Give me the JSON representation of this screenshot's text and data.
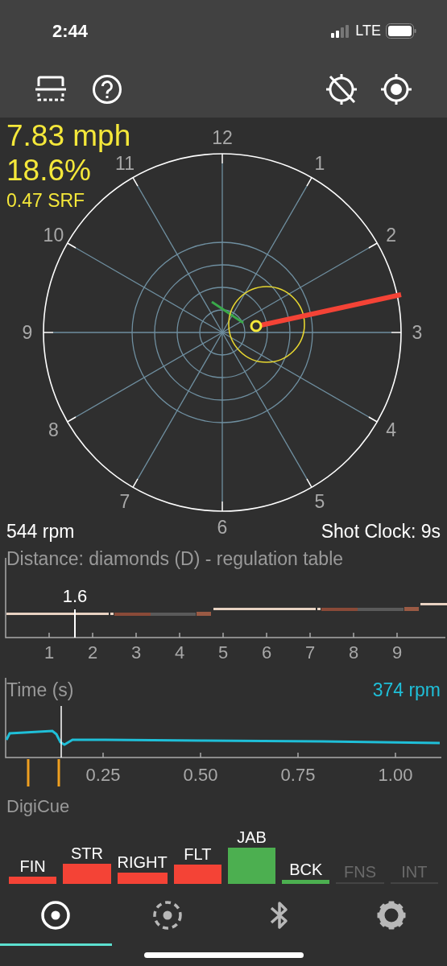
{
  "status_bar": {
    "time": "2:44",
    "network": "LTE"
  },
  "toolbar": [
    {
      "kind": "table"
    },
    {
      "kind": "help"
    },
    {
      "kind": "crosshair-off"
    },
    {
      "kind": "crosshair"
    }
  ],
  "readout": {
    "speed": "7.83 mph",
    "percent": "18.6%",
    "srf": "0.47 SRF"
  },
  "clock_labels": [
    "12",
    "1",
    "2",
    "3",
    "4",
    "5",
    "6",
    "7",
    "8",
    "9",
    "10",
    "11"
  ],
  "spin": "544 rpm",
  "shot_clock": "Shot Clock: 9s",
  "distance": {
    "title": "Distance: diamonds (D) - regulation table",
    "ticks": [
      "1",
      "2",
      "3",
      "4",
      "5",
      "6",
      "7",
      "8",
      "9"
    ],
    "marker": {
      "label": "1.6"
    }
  },
  "time": {
    "title": "Time (s)",
    "reading": "374 rpm",
    "ticks": [
      "0.25",
      "0.50",
      "0.75",
      "1.00"
    ]
  },
  "digicue": {
    "title": "DigiCue",
    "bars": [
      {
        "label": "FIN",
        "color": "#f44336",
        "disabled": false
      },
      {
        "label": "STR",
        "color": "#f44336",
        "disabled": false
      },
      {
        "label": "RIGHT",
        "color": "#f44336",
        "disabled": false
      },
      {
        "label": "FLT",
        "color": "#f44336",
        "disabled": false
      },
      {
        "label": "JAB",
        "color": "#4caf50",
        "disabled": false
      },
      {
        "label": "BCK",
        "color": "#4caf50",
        "disabled": false
      },
      {
        "label": "FNS",
        "color": "#444444",
        "disabled": true
      },
      {
        "label": "INT",
        "color": "#444444",
        "disabled": true
      }
    ]
  },
  "tabs": [
    {
      "kind": "target",
      "selected": true
    },
    {
      "kind": "dashed-target",
      "selected": false
    },
    {
      "kind": "bluetooth",
      "selected": false
    },
    {
      "kind": "settings",
      "selected": false
    }
  ]
}
